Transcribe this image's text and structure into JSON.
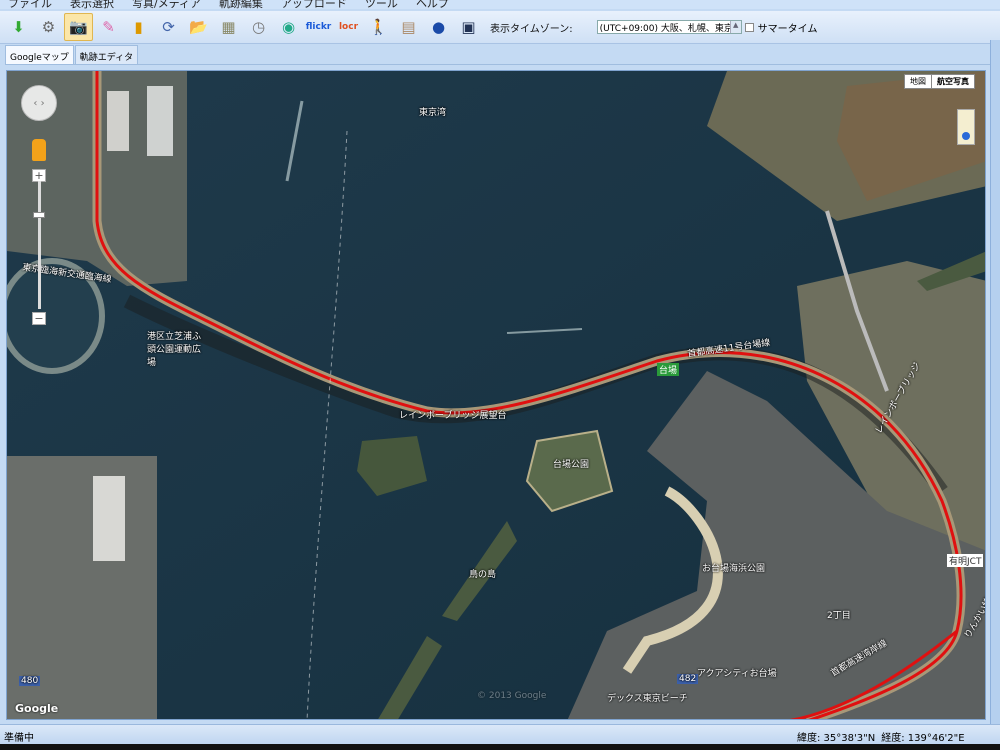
{
  "menu": [
    "ファイル",
    "表示選択",
    "写真/メディア",
    "軌跡編集",
    "アップロード",
    "ツール",
    "ヘルプ"
  ],
  "toolbar": {
    "icons": [
      "gps-import-icon",
      "gps-device-icon",
      "camera-icon",
      "edit-icon",
      "chart-icon",
      "sync-icon",
      "folder-open-icon",
      "photos-icon",
      "clock-icon",
      "web-icon",
      "flickr-icon",
      "locr-icon",
      "walker-icon",
      "export-icon",
      "google-earth-icon",
      "kmz-icon"
    ],
    "flickr": "flickr",
    "locr": "locr",
    "timezone_label": "表示タイムゾーン:",
    "timezone_value": "(UTC+09:00) 大阪、札幌、東京",
    "summer_time_label": "サマータイム",
    "summer_time_checked": false
  },
  "tabs": [
    {
      "label": "Googleマップ",
      "selected": true
    },
    {
      "label": "軌跡エディタ",
      "selected": false
    }
  ],
  "map": {
    "type_buttons": [
      "地図",
      "航空写真"
    ],
    "active_type": "航空写真",
    "zoom_plus": "+",
    "zoom_minus": "−",
    "google_logo": "Google",
    "route_color": "#e01010",
    "labels": {
      "bay": "東京湾",
      "expressway": "首都高速11号台場線",
      "daiba": "台場",
      "bridge_view": "レインボーブリッジ展望台",
      "daiba_park": "台場公園",
      "shibaura_park": "港区立芝浦ふ頭公園運動広場",
      "yurikamome": "東京臨海新交通臨海線",
      "odaiba_beach": "お台場海浜公園",
      "island": "鳥の島",
      "rainbow": "レインボーブリッジ",
      "odaiba_station": "お台場海浜公園",
      "ariake_jct": "有明JCT",
      "bayshore": "首都高速湾岸線",
      "rinkai": "りんかい線",
      "sec2": "2丁目",
      "aqua": "アクアシティお台場",
      "decks": "デックス東京ビーチ",
      "route_482": "482",
      "route_480": "480"
    },
    "copyright": "© 2013 Google"
  },
  "status": {
    "text": "準備中",
    "latitude": "緯度: 35°38'3\"N",
    "longitude": "経度: 139°46'2\"E"
  }
}
